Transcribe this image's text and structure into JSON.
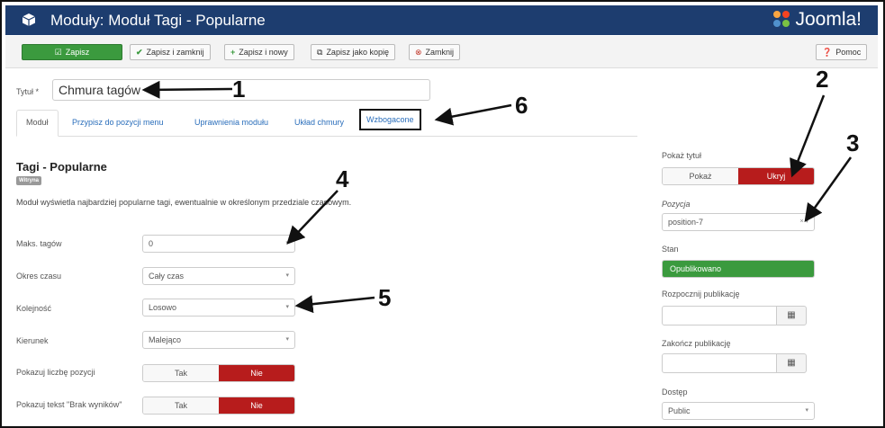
{
  "header": {
    "title": "Moduły: Moduł Tagi - Popularne",
    "logo_text": "Joomla!"
  },
  "toolbar": {
    "save": "Zapisz",
    "save_close": "Zapisz i zamknij",
    "save_new": "Zapisz i nowy",
    "save_copy": "Zapisz jako kopię",
    "close": "Zamknij",
    "help": "Pomoc"
  },
  "title_field": {
    "label": "Tytuł *",
    "value": "Chmura tagów"
  },
  "tabs": [
    "Moduł",
    "Przypisz do pozycji menu",
    "Uprawnienia modułu",
    "Układ chmury",
    "Wzbogacone"
  ],
  "module": {
    "heading": "Tagi - Popularne",
    "badge": "Witryna",
    "description": "Moduł wyświetla najbardziej popularne tagi, ewentualnie w określonym przedziale czasowym."
  },
  "fields": {
    "max_tags": {
      "label": "Maks. tagów",
      "value": "0"
    },
    "period": {
      "label": "Okres czasu",
      "value": "Cały czas"
    },
    "order": {
      "label": "Kolejność",
      "value": "Losowo"
    },
    "direction": {
      "label": "Kierunek",
      "value": "Malejąco"
    },
    "show_count": {
      "label": "Pokazuj liczbę pozycji",
      "yes": "Tak",
      "no": "Nie"
    },
    "show_no_results": {
      "label": "Pokazuj tekst \"Brak wyników\"",
      "yes": "Tak",
      "no": "Nie"
    }
  },
  "sidebar": {
    "show_title": {
      "label": "Pokaż tytuł",
      "show": "Pokaż",
      "hide": "Ukryj"
    },
    "position": {
      "label": "Pozycja",
      "value": "position-7"
    },
    "status": {
      "label": "Stan",
      "value": "Opublikowano"
    },
    "publish_up": {
      "label": "Rozpocznij publikację"
    },
    "publish_down": {
      "label": "Zakończ publikację"
    },
    "access": {
      "label": "Dostęp",
      "value": "Public"
    }
  },
  "annotations": [
    "1",
    "2",
    "3",
    "4",
    "5",
    "6"
  ],
  "colors": {
    "header": "#1d3d6f",
    "save_green": "#3b9a3e",
    "active_red": "#b71c1c"
  }
}
